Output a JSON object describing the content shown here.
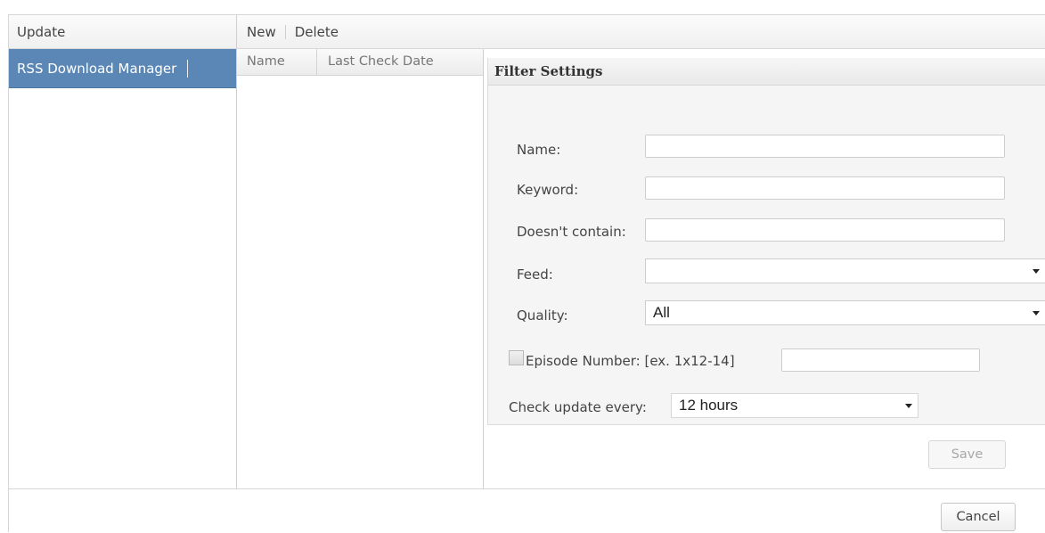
{
  "sidebar": {
    "header": "Update",
    "items": [
      {
        "label": "RSS Download Manager",
        "selected": true
      }
    ]
  },
  "toolbar": {
    "new_label": "New",
    "delete_label": "Delete"
  },
  "feed_list": {
    "columns": [
      "Name",
      "Last Check Date"
    ],
    "rows": []
  },
  "filter_settings": {
    "title": "Filter Settings",
    "name_label": "Name:",
    "name_value": "",
    "keyword_label": "Keyword:",
    "keyword_value": "",
    "exclude_label": "Doesn't contain:",
    "exclude_value": "",
    "feed_label": "Feed:",
    "feed_value": "",
    "quality_label": "Quality:",
    "quality_value": "All",
    "episode_label": "Episode Number: [ex. 1x12-14]",
    "episode_checked": false,
    "episode_value": "",
    "check_update_label": "Check update every:",
    "check_update_value": "12 hours",
    "save_label": "Save"
  },
  "footer": {
    "cancel_label": "Cancel"
  },
  "colors": {
    "selected_bg": "#5a87b5",
    "panel_bg": "#f5f5f5"
  }
}
